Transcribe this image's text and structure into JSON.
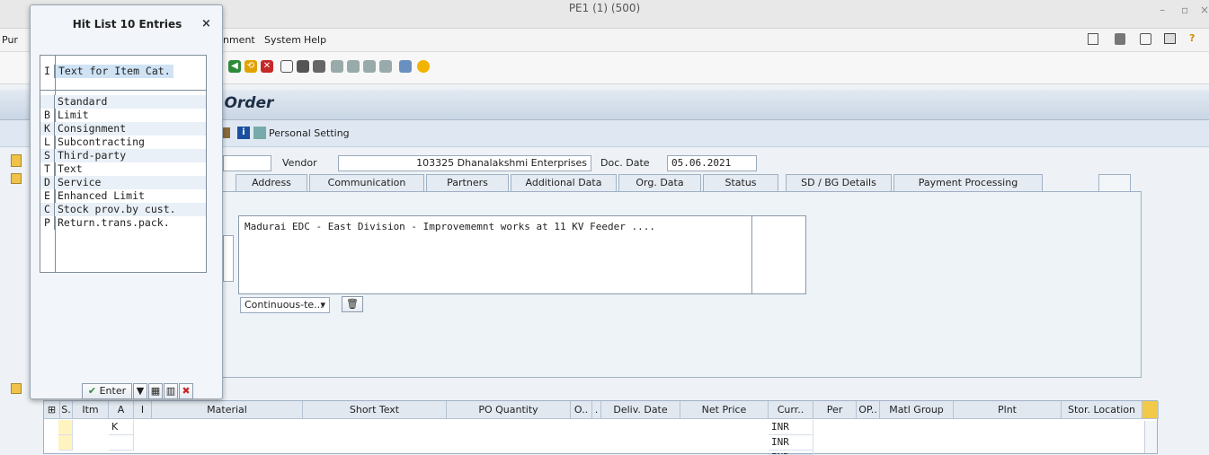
{
  "window": {
    "title": "PE1 (1) (500)",
    "minimize": "–",
    "maximize": "▫",
    "close": "×"
  },
  "menu": {
    "partial_left": "Pur",
    "items": [
      "nment",
      "System",
      "Help"
    ]
  },
  "header": {
    "title": "e Order"
  },
  "app_toolbar": {
    "personal_setting": "Personal Setting",
    "partial": "d"
  },
  "doc": {
    "vendor_label": "Vendor",
    "vendor_value": "103325 Dhanalakshmi Enterprises",
    "doc_date_label": "Doc. Date",
    "doc_date_value": "05.06.2021"
  },
  "tabs": [
    "Address",
    "Communication",
    "Partners",
    "Additional Data",
    "Org. Data",
    "Status",
    "SD / BG Details",
    "Payment Processing"
  ],
  "text_editor": {
    "content": "Madurai EDC - East Division - Improvememnt works at 11 KV Feeder ....",
    "format_select": "Continuous-te..."
  },
  "popup": {
    "title": "Hit List 10 Entries",
    "close": "×",
    "header_key": "I",
    "header_value": "Text for Item Cat.",
    "rows": [
      {
        "key": " ",
        "value": "Standard"
      },
      {
        "key": "B",
        "value": "Limit"
      },
      {
        "key": "K",
        "value": "Consignment"
      },
      {
        "key": "L",
        "value": "Subcontracting"
      },
      {
        "key": "S",
        "value": "Third-party"
      },
      {
        "key": "T",
        "value": "Text"
      },
      {
        "key": "D",
        "value": "Service"
      },
      {
        "key": "E",
        "value": "Enhanced Limit"
      },
      {
        "key": "C",
        "value": "Stock prov.by cust."
      },
      {
        "key": "P",
        "value": "Return.trans.pack."
      }
    ],
    "enter_label": "Enter"
  },
  "grid": {
    "columns": [
      "S.",
      "Itm",
      "A",
      "I",
      "Material",
      "Short Text",
      "PO Quantity",
      "O..",
      ".",
      "Deliv. Date",
      "Net Price",
      "Curr..",
      "Per",
      "OP..",
      "Matl Group",
      "Plnt",
      "Stor. Location"
    ],
    "rows": [
      {
        "A": "K",
        "Curr": "INR"
      },
      {
        "A": "",
        "Curr": "INR"
      },
      {
        "A": "",
        "Curr": "INR"
      }
    ]
  },
  "colors": {
    "accent": "#1f2f46",
    "selection": "#cfe3f5"
  }
}
